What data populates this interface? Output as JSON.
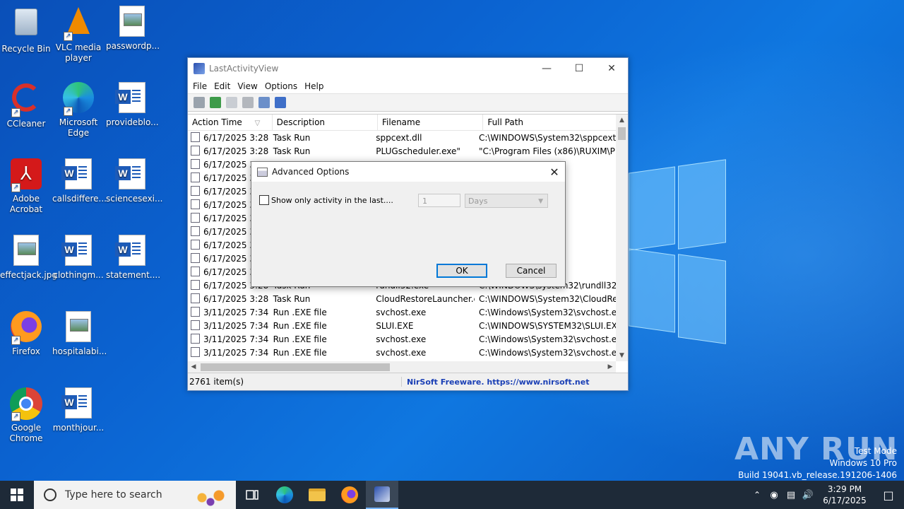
{
  "desktop": {
    "icons": [
      {
        "label": "Recycle Bin"
      },
      {
        "label": "VLC media player"
      },
      {
        "label": "passwordp..."
      },
      {
        "label": "CCleaner"
      },
      {
        "label": "Microsoft Edge"
      },
      {
        "label": "provideblo..."
      },
      {
        "label": "Adobe Acrobat"
      },
      {
        "label": "callsdiffere..."
      },
      {
        "label": "sciencesexi..."
      },
      {
        "label": "effectjack.jpg"
      },
      {
        "label": "clothingm..."
      },
      {
        "label": "statement...."
      },
      {
        "label": "Firefox"
      },
      {
        "label": "hospitalabi..."
      },
      {
        "label": "Google Chrome"
      },
      {
        "label": "monthjour..."
      }
    ]
  },
  "window": {
    "title": "LastActivityView",
    "menu": [
      "File",
      "Edit",
      "View",
      "Options",
      "Help"
    ],
    "columns": [
      "Action Time",
      "Description",
      "Filename",
      "Full Path"
    ],
    "rows": [
      [
        "6/17/2025 3:28:2...",
        "Task Run",
        "sppcext.dll",
        "C:\\WINDOWS\\System32\\sppcext.d"
      ],
      [
        "6/17/2025 3:28:2...",
        "Task Run",
        "PLUGscheduler.exe\"",
        "\"C:\\Program Files (x86)\\RUXIM\\PL"
      ],
      [
        "6/17/2025 3:",
        "",
        "",
        ""
      ],
      [
        "6/17/2025 3:",
        "",
        "",
        "m32\\MusNoti"
      ],
      [
        "6/17/2025 3:",
        "",
        "",
        "m32\\usoclient"
      ],
      [
        "6/17/2025 3:",
        "",
        "",
        "m32\\usoclient"
      ],
      [
        "6/17/2025 3:",
        "",
        "",
        "m32\\AppListB"
      ],
      [
        "6/17/2025 3:",
        "",
        "",
        "ozilla Firefox\\c"
      ],
      [
        "6/17/2025 3:",
        "",
        "",
        "m32\\PrinterCl"
      ],
      [
        "6/17/2025 3:",
        "",
        "",
        "m32\\sppcext.d"
      ],
      [
        "6/17/2025 3:",
        "",
        "",
        "86)\\Google\\G"
      ],
      [
        "6/17/2025 3:28:2...",
        "Task Run",
        "rundll32.exe",
        "C:\\WINDOWS\\system32\\rundll32."
      ],
      [
        "6/17/2025 3:28:2...",
        "Task Run",
        "CloudRestoreLauncher.dll",
        "C:\\WINDOWS\\System32\\CloudRe"
      ],
      [
        "3/11/2025 7:34:3...",
        "Run .EXE file",
        "svchost.exe",
        "C:\\Windows\\System32\\svchost.ex"
      ],
      [
        "3/11/2025 7:34:3...",
        "Run .EXE file",
        "SLUI.EXE",
        "C:\\WINDOWS\\SYSTEM32\\SLUI.EXE"
      ],
      [
        "3/11/2025 7:34:3...",
        "Run .EXE file",
        "svchost.exe",
        "C:\\Windows\\System32\\svchost.ex"
      ],
      [
        "3/11/2025 7:34:3...",
        "Run .EXE file",
        "svchost.exe",
        "C:\\Windows\\System32\\svchost.ex"
      ]
    ],
    "status_count": "2761 item(s)",
    "status_link": "NirSoft Freeware. https://www.nirsoft.net"
  },
  "dialog": {
    "title": "Advanced Options",
    "checkbox_label": "Show only activity in the last....",
    "checkbox_checked": false,
    "number_value": "1",
    "unit_value": "Days",
    "ok_label": "OK",
    "cancel_label": "Cancel"
  },
  "taskbar": {
    "search_placeholder": "Type here to search",
    "time": "3:29 PM",
    "date": "6/17/2025"
  },
  "watermark": {
    "brand": "ANY RUN",
    "line1": "Test Mode",
    "line2": "Windows 10 Pro",
    "line3": "Build 19041.vb_release.191206-1406"
  }
}
